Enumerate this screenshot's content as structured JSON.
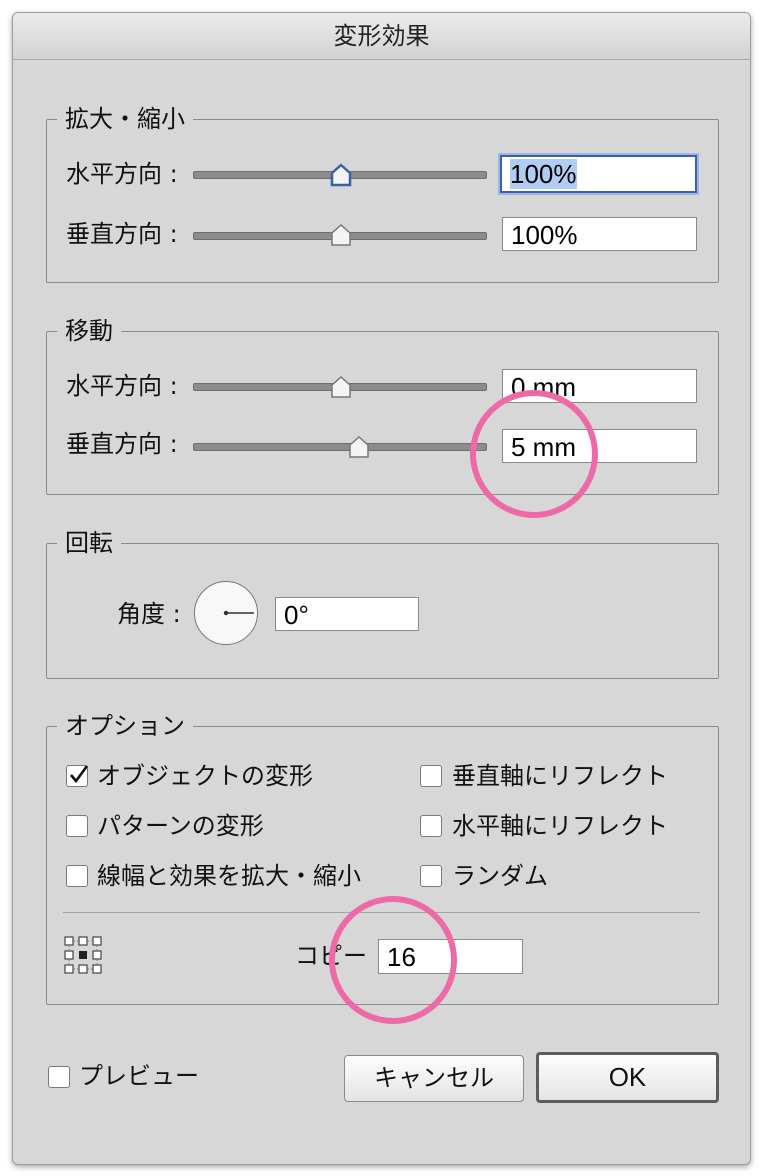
{
  "dialog": {
    "title": "変形効果"
  },
  "scale": {
    "label": "拡大・縮小",
    "horizontal_label": "水平方向 :",
    "horizontal_value": "100%",
    "vertical_label": "垂直方向 :",
    "vertical_value": "100%"
  },
  "move": {
    "label": "移動",
    "horizontal_label": "水平方向 :",
    "horizontal_value": "0 mm",
    "vertical_label": "垂直方向 :",
    "vertical_value": "5 mm"
  },
  "rotate": {
    "label": "回転",
    "angle_label": "角度 :",
    "angle_value": "0°"
  },
  "options": {
    "label": "オプション",
    "transform_objects": {
      "label": "オブジェクトの変形",
      "checked": true
    },
    "transform_patterns": {
      "label": "パターンの変形",
      "checked": false
    },
    "scale_strokes": {
      "label": "線幅と効果を拡大・縮小",
      "checked": false
    },
    "reflect_y": {
      "label": "垂直軸にリフレクト",
      "checked": false
    },
    "reflect_x": {
      "label": "水平軸にリフレクト",
      "checked": false
    },
    "random": {
      "label": "ランダム",
      "checked": false
    },
    "reference_point_icon": "reference-point-grid-icon",
    "copies_label": "コピー",
    "copies_value": "16"
  },
  "footer": {
    "preview_label": "プレビュー",
    "preview_checked": false,
    "cancel_label": "キャンセル",
    "ok_label": "OK"
  },
  "colors": {
    "highlight_ring": "#ee6aa7",
    "focus_border": "#3d5fa8",
    "text_selection": "#b2cdf3"
  }
}
